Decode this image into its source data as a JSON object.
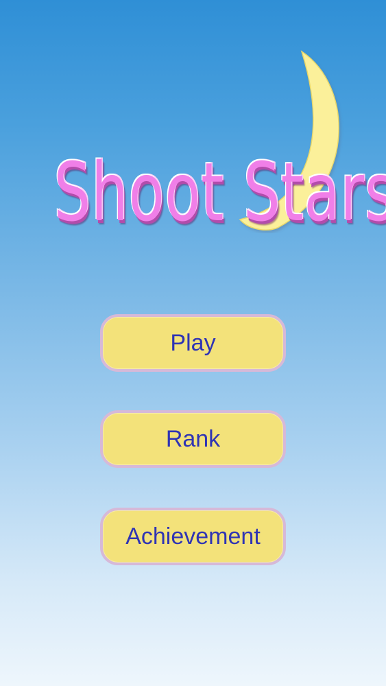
{
  "game": {
    "title": "Shoot Stars"
  },
  "menu": {
    "play_label": "Play",
    "rank_label": "Rank",
    "achievement_label": "Achievement"
  },
  "colors": {
    "sky_top": "#2f8fd6",
    "sky_bottom": "#eef6fc",
    "title_pink": "#f07fe8",
    "moon_yellow": "#fbf09a",
    "button_fill": "#f3e27a",
    "button_border": "#d6b9d8",
    "button_text": "#2f34b4"
  },
  "icons": {
    "moon": "crescent-moon-icon",
    "sparkle": "sparkle-star-icon"
  }
}
